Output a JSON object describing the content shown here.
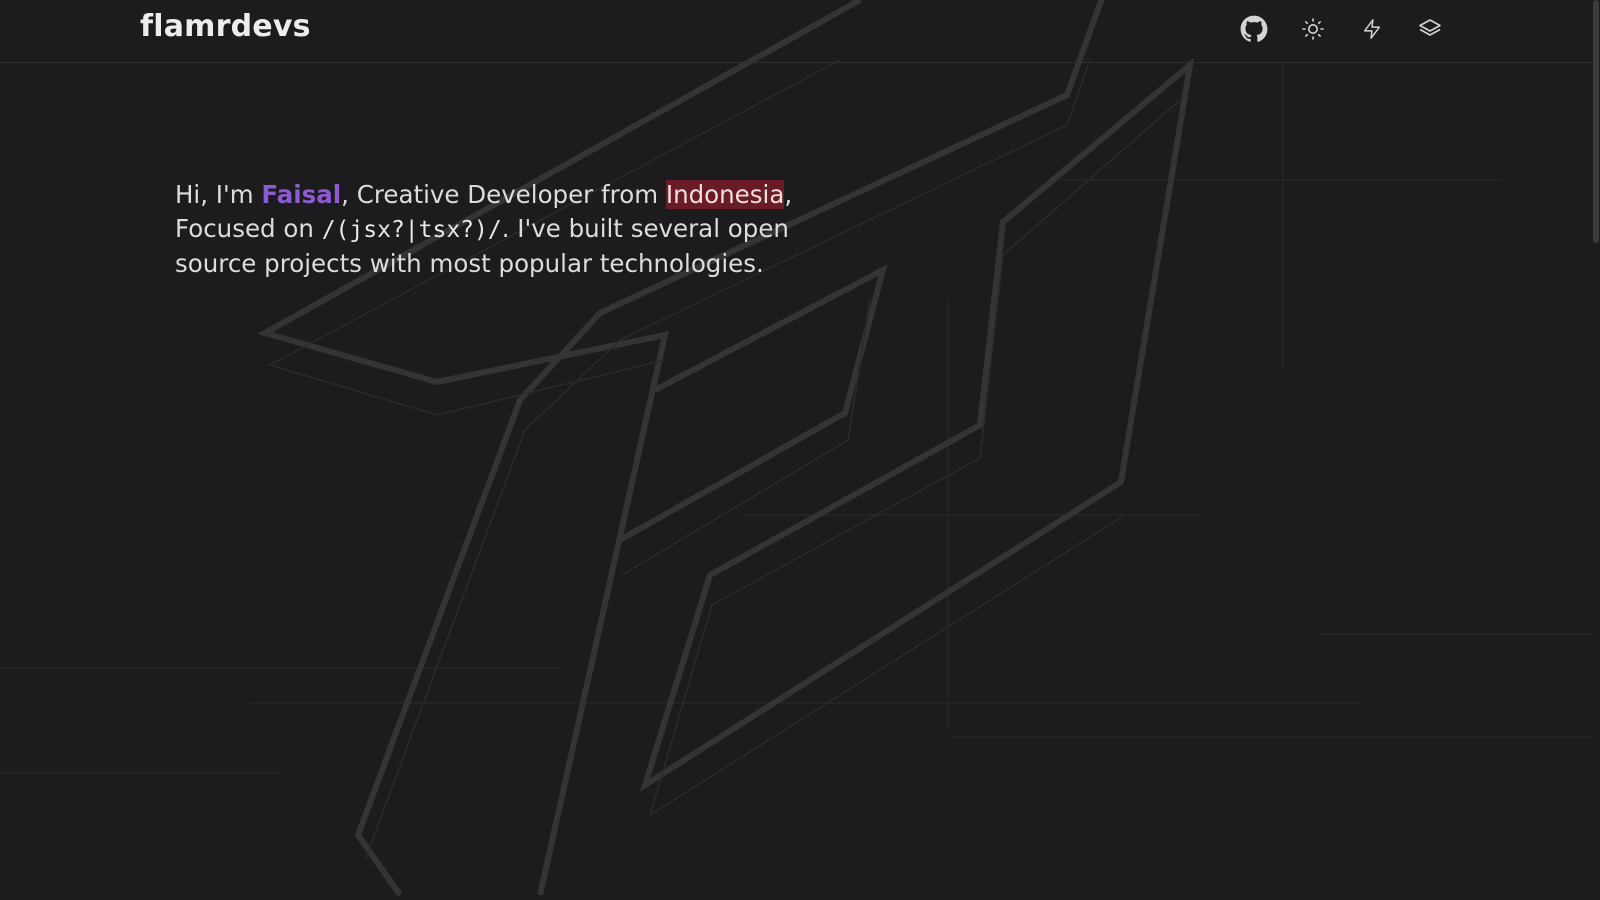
{
  "header": {
    "logo": "flamrdevs",
    "icons": [
      {
        "name": "github-icon",
        "label": "GitHub"
      },
      {
        "name": "sun-icon",
        "label": "Theme"
      },
      {
        "name": "bolt-icon",
        "label": "Projects"
      },
      {
        "name": "layers-icon",
        "label": "Stack"
      }
    ]
  },
  "intro": {
    "greeting": "Hi, I'm ",
    "name": "Faisal",
    "role": ", Creative Developer from ",
    "country": "Indonesia",
    "comma": ",",
    "focused": "Focused on ",
    "regex": "/(jsx?|tsx?)/",
    "rest": ". I've built several open source projects with most popular technologies."
  },
  "colors": {
    "background": "#1c1c1e",
    "accent": "#8d5bd1",
    "highlight": "#aa1e2d"
  }
}
